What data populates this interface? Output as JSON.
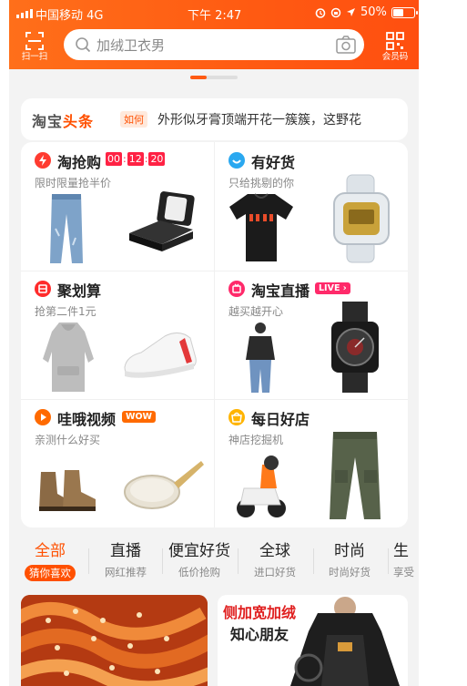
{
  "status_bar": {
    "carrier": "中国移动 4G",
    "time": "下午 2:47",
    "battery": "50%",
    "battery_level": 0.5
  },
  "header": {
    "scan_label": "扫一扫",
    "search_placeholder": "加绒卫衣男",
    "member_label": "会员码"
  },
  "headline": {
    "logo_prefix": "淘宝",
    "logo_suffix": "头条",
    "tag": "如何",
    "text": "外形似牙膏顶端开花一簇簇，这野花"
  },
  "features": [
    {
      "title": "淘抢购",
      "subtitle": "限时限量抢半价",
      "icon": "lightning-icon",
      "color": "#ff3b30"
    },
    {
      "title": "有好货",
      "subtitle": "只给挑剔的你",
      "icon": "smile-icon",
      "color": "#2aa8f0"
    },
    {
      "title": "聚划算",
      "subtitle": "抢第二件1元",
      "icon": "ju-icon",
      "color": "#ff2b2b"
    },
    {
      "title": "淘宝直播",
      "subtitle": "越买越开心",
      "icon": "live-icon",
      "color": "#ff2a6a"
    },
    {
      "title": "哇哦视频",
      "subtitle": "亲测什么好买",
      "icon": "play-icon",
      "color": "#ff6a00"
    },
    {
      "title": "每日好店",
      "subtitle": "神店挖掘机",
      "icon": "shop-icon",
      "color": "#ffb400"
    }
  ],
  "countdown": {
    "h": "00",
    "m": "12",
    "s": "20"
  },
  "tags": {
    "live": "LIVE",
    "wow": "WOW"
  },
  "tabs": [
    {
      "title": "全部",
      "subtitle": "猜你喜欢",
      "active": true
    },
    {
      "title": "直播",
      "subtitle": "网红推荐"
    },
    {
      "title": "便宜好货",
      "subtitle": "低价抢购"
    },
    {
      "title": "全球",
      "subtitle": "进口好货"
    },
    {
      "title": "时尚",
      "subtitle": "时尚好货"
    },
    {
      "title": "生",
      "subtitle": "享受"
    }
  ],
  "feed": {
    "promo_line1": "侧加宽加绒",
    "promo_line2": "知心朋友"
  }
}
